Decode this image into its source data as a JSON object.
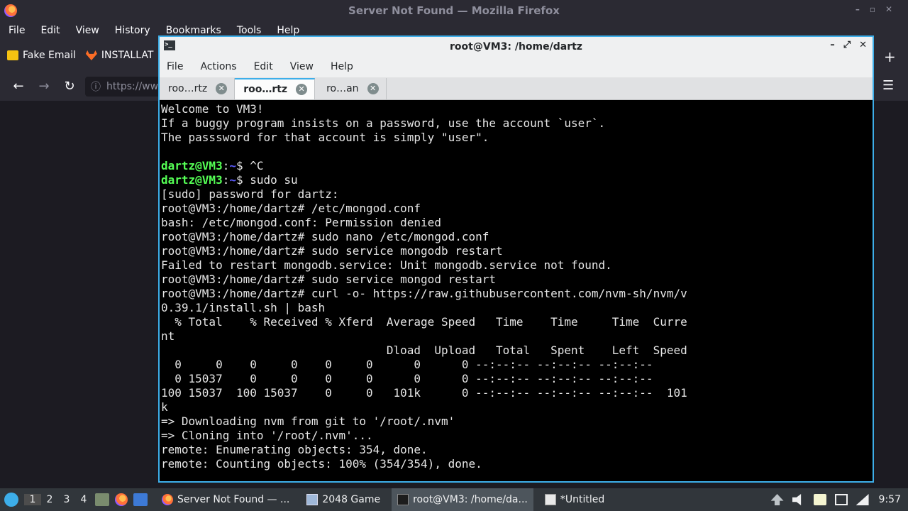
{
  "firefox": {
    "window_title": "Server Not Found — Mozilla Firefox",
    "menu": [
      "File",
      "Edit",
      "View",
      "History",
      "Bookmarks",
      "Tools",
      "Help"
    ],
    "bookmarks": [
      {
        "label": "Fake Email",
        "icon": "envelope-icon"
      },
      {
        "label": "INSTALLAT",
        "icon": "gitlab-icon"
      }
    ],
    "url_text": "https://ww",
    "colors": {
      "chrome_bg": "#2b2a33",
      "content_bg": "#1c1b22"
    }
  },
  "terminal": {
    "title": "root@VM3: /home/dartz",
    "menu": [
      "File",
      "Actions",
      "Edit",
      "View",
      "Help"
    ],
    "tabs": [
      {
        "label": "roo…rtz",
        "active": false
      },
      {
        "label": "roo…rtz",
        "active": true
      },
      {
        "label": "ro…an",
        "active": false
      }
    ],
    "lines": [
      "Welcome to VM3!",
      "If a buggy program insists on a password, use the account `user`.",
      "The passsword for that account is simply \"user\".",
      "",
      {
        "user": "dartz@VM3",
        "path": "~",
        "cmd": "$ ^C"
      },
      {
        "user": "dartz@VM3",
        "path": "~",
        "cmd": "$ sudo su"
      },
      "[sudo] password for dartz:",
      "root@VM3:/home/dartz# /etc/mongod.conf",
      "bash: /etc/mongod.conf: Permission denied",
      "root@VM3:/home/dartz# sudo nano /etc/mongod.conf",
      "root@VM3:/home/dartz# sudo service mongodb restart",
      "Failed to restart mongodb.service: Unit mongodb.service not found.",
      "root@VM3:/home/dartz# sudo service mongod restart",
      "root@VM3:/home/dartz# curl -o- https://raw.githubusercontent.com/nvm-sh/nvm/v",
      "0.39.1/install.sh | bash",
      "  % Total    % Received % Xferd  Average Speed   Time    Time     Time  Curre",
      "nt",
      "                                 Dload  Upload   Total   Spent    Left  Speed",
      "  0     0    0     0    0     0      0      0 --:--:-- --:--:-- --:--:--",
      "  0 15037    0     0    0     0      0      0 --:--:-- --:--:-- --:--:--",
      "100 15037  100 15037    0     0   101k      0 --:--:-- --:--:-- --:--:--  101",
      "k",
      "=> Downloading nvm from git to '/root/.nvm'",
      "=> Cloning into '/root/.nvm'...",
      "remote: Enumerating objects: 354, done.",
      "remote: Counting objects: 100% (354/354), done."
    ],
    "colors": {
      "accent": "#3daee9",
      "prompt_user": "#55ff55",
      "prompt_path": "#5c5cff"
    }
  },
  "taskbar": {
    "workspaces": [
      "1",
      "2",
      "3",
      "4"
    ],
    "tasks": [
      {
        "label": "Server Not Found — ...",
        "icon": "firefox-icon",
        "active": false
      },
      {
        "label": "2048 Game",
        "icon": "window-icon",
        "active": false
      },
      {
        "label": "root@VM3: /home/da...",
        "icon": "terminal-icon",
        "active": true
      },
      {
        "label": "*Untitled",
        "icon": "text-editor-icon",
        "active": false
      }
    ],
    "clock": "9:57"
  }
}
